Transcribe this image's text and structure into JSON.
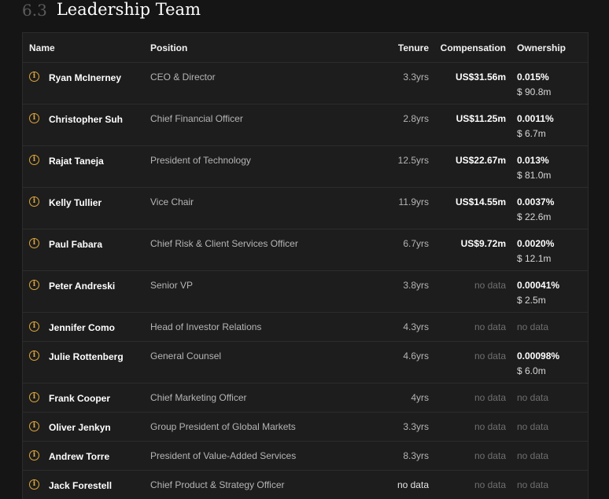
{
  "section": {
    "number": "6.3",
    "title": "Leadership Team"
  },
  "columns": {
    "name": "Name",
    "position": "Position",
    "tenure": "Tenure",
    "compensation": "Compensation",
    "ownership": "Ownership"
  },
  "rows": [
    {
      "name": "Ryan McInerney",
      "position": "CEO & Director",
      "tenure": "3.3yrs",
      "compensation": "US$31.56m",
      "ownership_pct": "0.015%",
      "ownership_value": "$ 90.8m"
    },
    {
      "name": "Christopher Suh",
      "position": "Chief Financial Officer",
      "tenure": "2.8yrs",
      "compensation": "US$11.25m",
      "ownership_pct": "0.0011%",
      "ownership_value": "$ 6.7m"
    },
    {
      "name": "Rajat Taneja",
      "position": "President of Technology",
      "tenure": "12.5yrs",
      "compensation": "US$22.67m",
      "ownership_pct": "0.013%",
      "ownership_value": "$ 81.0m"
    },
    {
      "name": "Kelly Tullier",
      "position": "Vice Chair",
      "tenure": "11.9yrs",
      "compensation": "US$14.55m",
      "ownership_pct": "0.0037%",
      "ownership_value": "$ 22.6m"
    },
    {
      "name": "Paul Fabara",
      "position": "Chief Risk & Client Services Officer",
      "tenure": "6.7yrs",
      "compensation": "US$9.72m",
      "ownership_pct": "0.0020%",
      "ownership_value": "$ 12.1m"
    },
    {
      "name": "Peter Andreski",
      "position": "Senior VP",
      "tenure": "3.8yrs",
      "compensation": "no data",
      "ownership_pct": "0.00041%",
      "ownership_value": "$ 2.5m"
    },
    {
      "name": "Jennifer Como",
      "position": "Head of Investor Relations",
      "tenure": "4.3yrs",
      "compensation": "no data",
      "ownership_pct": "no data",
      "ownership_value": ""
    },
    {
      "name": "Julie Rottenberg",
      "position": "General Counsel",
      "tenure": "4.6yrs",
      "compensation": "no data",
      "ownership_pct": "0.00098%",
      "ownership_value": "$ 6.0m"
    },
    {
      "name": "Frank Cooper",
      "position": "Chief Marketing Officer",
      "tenure": "4yrs",
      "compensation": "no data",
      "ownership_pct": "no data",
      "ownership_value": ""
    },
    {
      "name": "Oliver Jenkyn",
      "position": "Group President of Global Markets",
      "tenure": "3.3yrs",
      "compensation": "no data",
      "ownership_pct": "no data",
      "ownership_value": ""
    },
    {
      "name": "Andrew Torre",
      "position": "President of Value-Added Services",
      "tenure": "8.3yrs",
      "compensation": "no data",
      "ownership_pct": "no data",
      "ownership_value": ""
    },
    {
      "name": "Jack Forestell",
      "position": "Chief Product & Strategy Officer",
      "tenure": "no data",
      "compensation": "no data",
      "ownership_pct": "no data",
      "ownership_value": ""
    }
  ],
  "icons": {
    "row_info": "info-circle-icon"
  },
  "colors": {
    "accent": "#e0a83a",
    "background": "#151515",
    "table_bg": "#1d1d1d"
  }
}
